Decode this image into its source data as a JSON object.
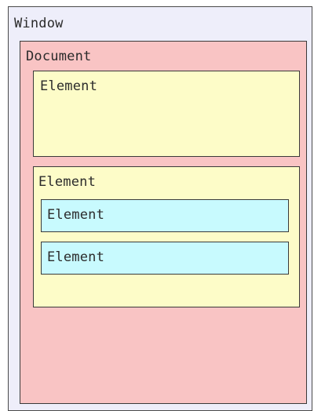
{
  "colors": {
    "window_fill": "#eeeefa",
    "document_fill": "#f9c4c4",
    "element_fill": "#fdfcc8",
    "nested_element_fill": "#c8fafe",
    "border": "#3a3a3a"
  },
  "window": {
    "label": "Window",
    "document": {
      "label": "Document",
      "elements": [
        {
          "label": "Element",
          "children": []
        },
        {
          "label": "Element",
          "children": [
            {
              "label": "Element"
            },
            {
              "label": "Element"
            }
          ]
        }
      ]
    }
  }
}
